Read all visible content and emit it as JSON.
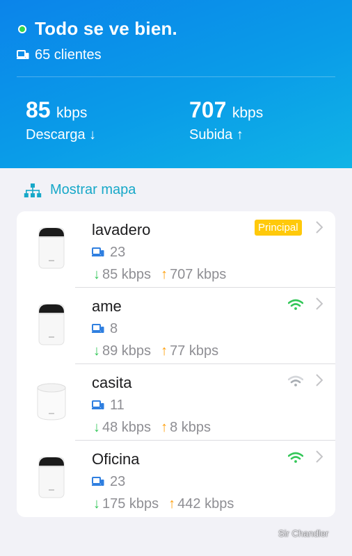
{
  "header": {
    "status_text": "Todo se ve bien.",
    "clients_text": "65 clientes",
    "download": {
      "value": "85",
      "unit": "kbps",
      "label": "Descarga ↓"
    },
    "upload": {
      "value": "707",
      "unit": "kbps",
      "label": "Subida ↑"
    }
  },
  "map_link": {
    "label": "Mostrar mapa",
    "icon": "network-map-icon"
  },
  "devices": [
    {
      "name": "lavadero",
      "clients": "23",
      "down": "85 kbps",
      "up": "707 kbps",
      "badge": "Principal",
      "signal": "none"
    },
    {
      "name": "ame",
      "clients": "8",
      "down": "89 kbps",
      "up": "77 kbps",
      "signal": "good",
      "signal_color": "#34c759"
    },
    {
      "name": "casita",
      "clients": "11",
      "down": "48 kbps",
      "up": "8 kbps",
      "signal": "weak",
      "signal_color": "#b8bcc2"
    },
    {
      "name": "Oficina",
      "clients": "23",
      "down": "175 kbps",
      "up": "442 kbps",
      "signal": "good",
      "signal_color": "#34c759"
    }
  ],
  "arrows": {
    "down": "↓",
    "up": "↑"
  },
  "watermark": "Sir Chandler",
  "colors": {
    "accent": "#17a8c8",
    "header_start": "#0b84ea",
    "header_end": "#10b4e6",
    "download": "#34c759",
    "upload": "#ff9f0a",
    "badge": "#ffc90a"
  }
}
